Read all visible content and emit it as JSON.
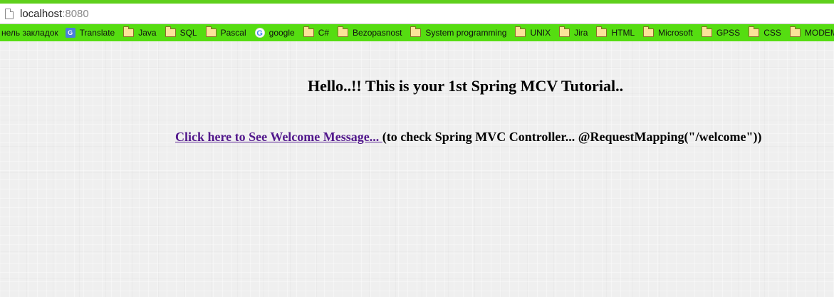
{
  "browser": {
    "url_host": "localhost",
    "url_port": ":8080"
  },
  "bookmarks": {
    "first_label": "нель закладок",
    "items": [
      {
        "label": "Translate",
        "icon": "translate-icon"
      },
      {
        "label": "Java",
        "icon": "folder-icon"
      },
      {
        "label": "SQL",
        "icon": "folder-icon"
      },
      {
        "label": "Pascal",
        "icon": "folder-icon"
      },
      {
        "label": "google",
        "icon": "google-icon"
      },
      {
        "label": "C#",
        "icon": "folder-icon"
      },
      {
        "label": "Bezopasnost",
        "icon": "folder-icon"
      },
      {
        "label": "System programming",
        "icon": "folder-icon"
      },
      {
        "label": "UNIX",
        "icon": "folder-icon"
      },
      {
        "label": "Jira",
        "icon": "folder-icon"
      },
      {
        "label": "HTML",
        "icon": "folder-icon"
      },
      {
        "label": "Microsoft",
        "icon": "folder-icon"
      },
      {
        "label": "GPSS",
        "icon": "folder-icon"
      },
      {
        "label": "CSS",
        "icon": "folder-icon"
      },
      {
        "label": "MODEM",
        "icon": "folder-icon"
      }
    ]
  },
  "page": {
    "heading": "Hello..!! This is your 1st Spring MCV Tutorial..",
    "link_text": "Click here to See Welcome Message... ",
    "link_suffix": "(to check Spring MVC Controller... @RequestMapping(\"/welcome\"))"
  },
  "colors": {
    "bookmark_bar": "#55dd11",
    "link": "#52188c"
  }
}
